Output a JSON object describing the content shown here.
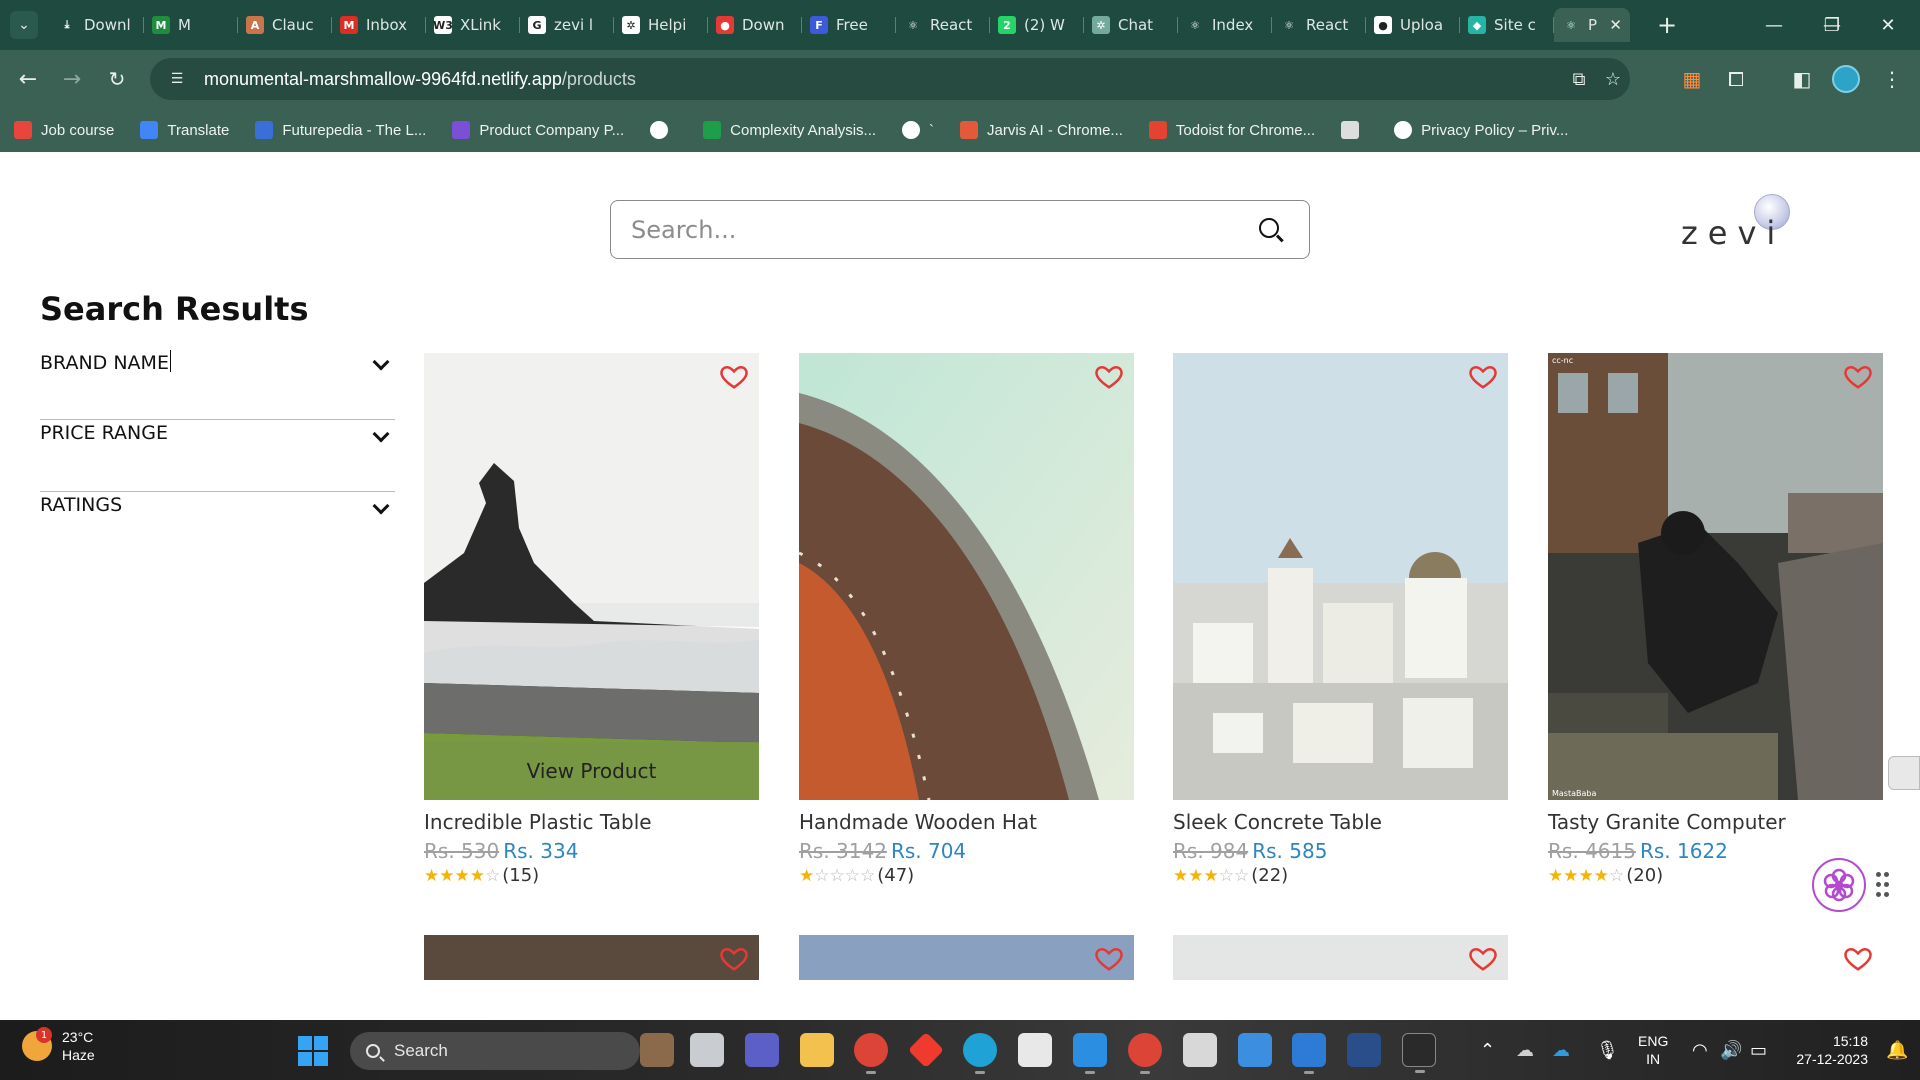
{
  "browser": {
    "tabs": [
      {
        "title": "Downl",
        "icon": "download-icon",
        "color": "#1e4a3f",
        "glyph": "⤓"
      },
      {
        "title": "M",
        "icon": "meet-icon",
        "color": "#1e8e3e",
        "glyph": "M"
      },
      {
        "title": "Clauc",
        "icon": "claude-icon",
        "color": "#c9754a",
        "glyph": "A"
      },
      {
        "title": "Inbox",
        "icon": "gmail-icon",
        "color": "#d93025",
        "glyph": "M"
      },
      {
        "title": "XLink",
        "icon": "w3-icon",
        "color": "#ffffff",
        "glyph": "W3"
      },
      {
        "title": "zevi l",
        "icon": "google-icon",
        "color": "#ffffff",
        "glyph": "G"
      },
      {
        "title": "Helpi",
        "icon": "openai-icon",
        "color": "#ffffff",
        "glyph": "✲"
      },
      {
        "title": "Down",
        "icon": "record-icon",
        "color": "#e53935",
        "glyph": "●"
      },
      {
        "title": "Free",
        "icon": "forms-icon",
        "color": "#3b5bdb",
        "glyph": "F"
      },
      {
        "title": "React",
        "icon": "react-icon",
        "color": "#1e4a3f",
        "glyph": "⚛"
      },
      {
        "title": "(2) W",
        "icon": "whatsapp-icon",
        "color": "#25d366",
        "glyph": "2"
      },
      {
        "title": "Chat",
        "icon": "chatgpt-icon",
        "color": "#74aa9c",
        "glyph": "✲"
      },
      {
        "title": "Index",
        "icon": "react-icon",
        "color": "#1e4a3f",
        "glyph": "⚛"
      },
      {
        "title": "React",
        "icon": "react-icon",
        "color": "#1e4a3f",
        "glyph": "⚛"
      },
      {
        "title": "Uploa",
        "icon": "github-icon",
        "color": "#ffffff",
        "glyph": "●"
      },
      {
        "title": "Site c",
        "icon": "netlify-icon",
        "color": "#26b5a5",
        "glyph": "◆"
      }
    ],
    "active_tab": {
      "title": "P",
      "icon": "react-icon",
      "close": "✕"
    },
    "new_tab": "+",
    "window_controls": {
      "minimize": "—",
      "maximize": "❐",
      "close": "✕"
    },
    "url": {
      "host": "monumental-marshmallow-9964fd.netlify.app",
      "path": "/products"
    },
    "bookmarks": [
      {
        "label": "Job course",
        "color": "#e8453c"
      },
      {
        "label": "Translate",
        "color": "#4285f4"
      },
      {
        "label": "Futurepedia - The L...",
        "color": "#3a6fd8"
      },
      {
        "label": "Product Company P...",
        "color": "#7b4fd6"
      },
      {
        "label": "",
        "color": "#ffffff"
      },
      {
        "label": "Complexity Analysis...",
        "color": "#1e9e4a"
      },
      {
        "label": "`",
        "color": "#ffffff"
      },
      {
        "label": "Jarvis AI - Chrome...",
        "color": "#e35a3b"
      },
      {
        "label": "Todoist for Chrome...",
        "color": "#e44332"
      },
      {
        "label": "",
        "color": "#dddddd"
      },
      {
        "label": "Privacy Policy – Priv...",
        "color": "#ffffff"
      }
    ]
  },
  "page": {
    "search": {
      "placeholder": "Search..."
    },
    "logo": "zevi",
    "results_title": "Search Results",
    "filters": [
      {
        "label": "BRAND NAME"
      },
      {
        "label": "PRICE RANGE"
      },
      {
        "label": "RATINGS"
      }
    ],
    "hover_overlay": "View Product",
    "products": [
      {
        "name": "Incredible Plastic Table",
        "old_price": "Rs. 530",
        "new_price": "Rs. 334",
        "rating": 4,
        "reviews": "(15)"
      },
      {
        "name": "Handmade Wooden Hat",
        "old_price": "Rs. 3142",
        "new_price": "Rs. 704",
        "rating": 1,
        "reviews": "(47)"
      },
      {
        "name": "Sleek Concrete Table",
        "old_price": "Rs. 984",
        "new_price": "Rs. 585",
        "rating": 3,
        "reviews": "(22)"
      },
      {
        "name": "Tasty Granite Computer",
        "old_price": "Rs. 4615",
        "new_price": "Rs. 1622",
        "rating": 4,
        "reviews": "(20)"
      }
    ],
    "image_watermarks": {
      "cc": "cc-nc",
      "author": "MastaBaba"
    },
    "colors": {
      "price_new": "#2e86c1",
      "price_old": "#a0a0a0",
      "star": "#f5b400",
      "heart": "#e53935"
    }
  },
  "taskbar": {
    "weather": {
      "temp": "23°C",
      "condition": "Haze",
      "badge": "1"
    },
    "search_label": "Search",
    "language": {
      "line1": "ENG",
      "line2": "IN"
    },
    "clock": {
      "time": "15:18",
      "date": "27-12-2023"
    }
  }
}
